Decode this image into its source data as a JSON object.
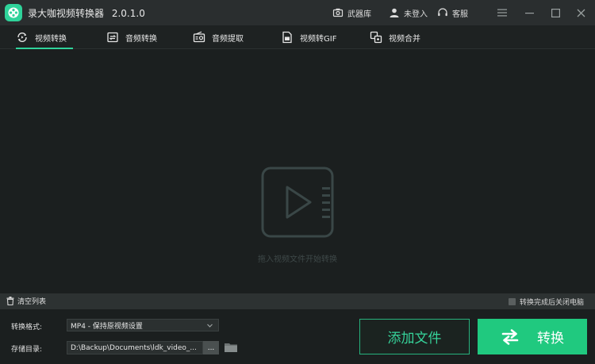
{
  "app": {
    "title": "录大咖视频转换器",
    "version": "2.0.1.0"
  },
  "titlebar": {
    "arsenal_label": "武器库",
    "login_label": "未登入",
    "support_label": "客服"
  },
  "tabs": [
    {
      "label": "视频转换",
      "icon": "video-convert-icon",
      "active": true
    },
    {
      "label": "音频转换",
      "icon": "audio-convert-icon",
      "active": false
    },
    {
      "label": "音频提取",
      "icon": "radio-icon",
      "active": false
    },
    {
      "label": "视频转GIF",
      "icon": "file-gif-icon",
      "active": false
    },
    {
      "label": "视频合并",
      "icon": "merge-icon",
      "active": false
    }
  ],
  "dropzone": {
    "hint": "拖入视频文件开始转换",
    "icon": "video-play-icon"
  },
  "listbar": {
    "clear_label": "清空列表",
    "shutdown_label": "转换完成后关闭电脑",
    "shutdown_checked": false
  },
  "settings": {
    "format_label": "转换格式:",
    "format_value": "MP4 - 保持原视频设置",
    "dir_label": "存储目录:",
    "dir_value": "D:\\Backup\\Documents\\ldk_video_...",
    "browse_label": "..."
  },
  "actions": {
    "add_file_label": "添加文件",
    "convert_label": "转换"
  },
  "colors": {
    "accent": "#20c97f",
    "background": "#1b1f1f",
    "titlebar": "#2a2e2f"
  }
}
